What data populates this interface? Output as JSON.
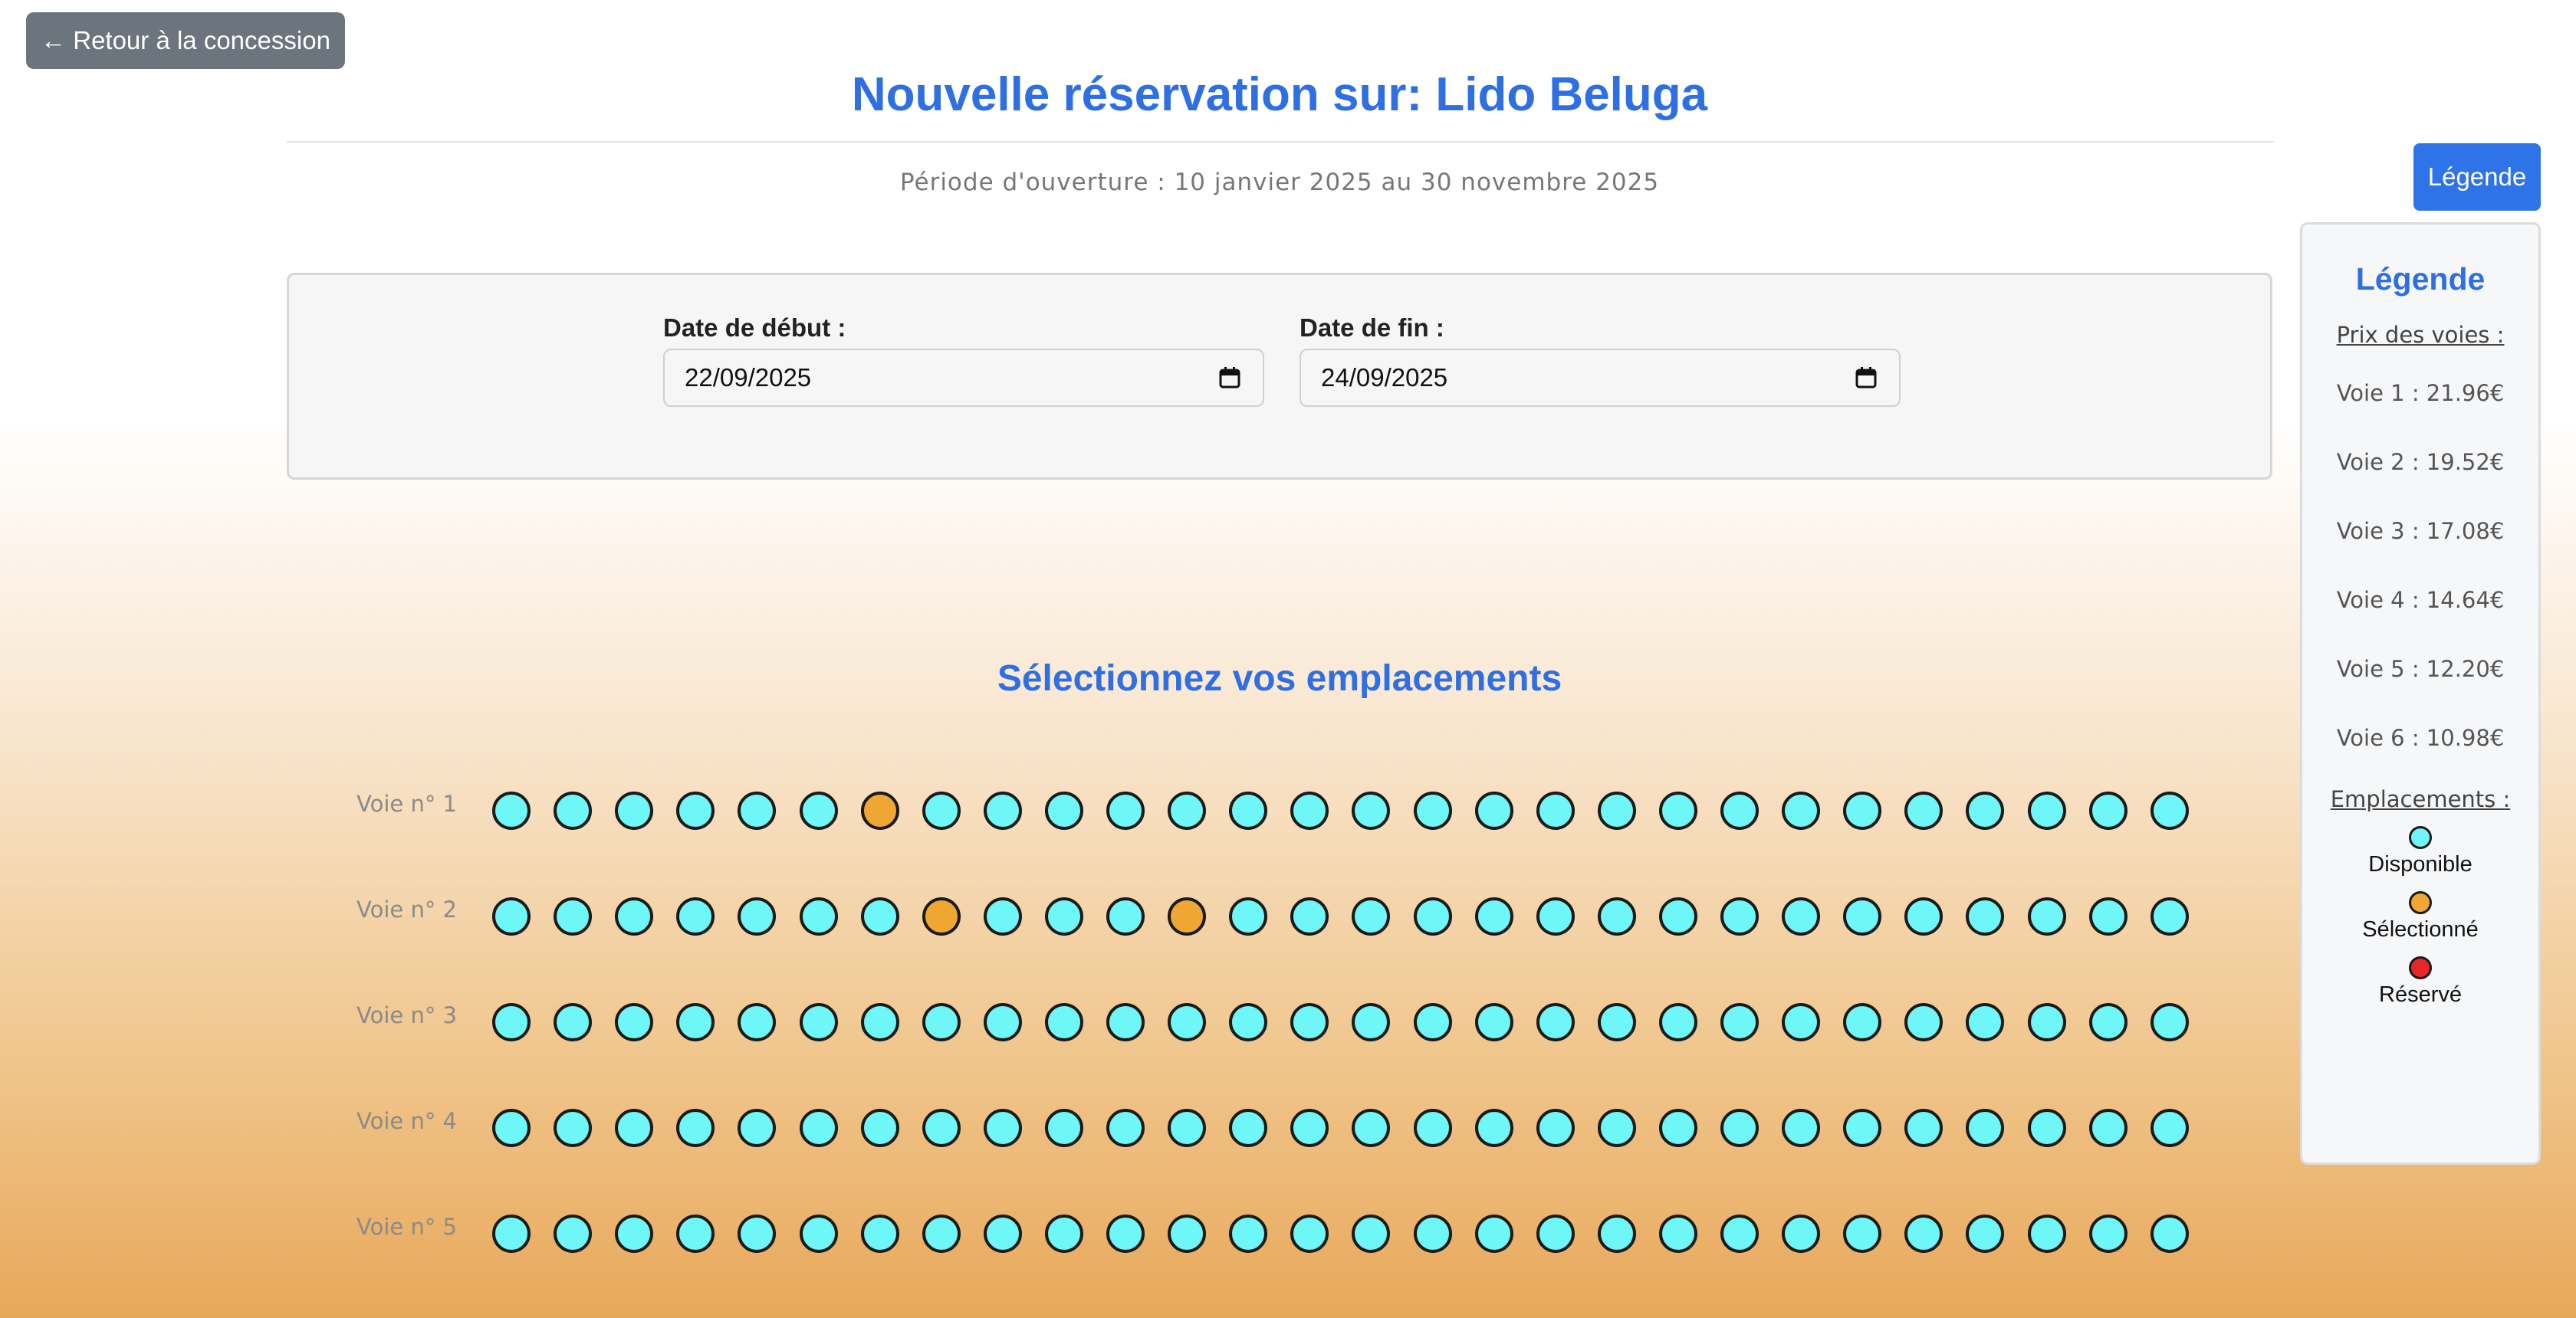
{
  "back_button": {
    "label": "← Retour à la concession"
  },
  "page": {
    "title": "Nouvelle réservation sur: Lido Beluga",
    "period": "Période d'ouverture : 10 janvier 2025 au 30 novembre 2025"
  },
  "dates": {
    "start_label": "Date de début :",
    "start_value": "22/09/2025",
    "end_label": "Date de fin :",
    "end_value": "24/09/2025"
  },
  "seating": {
    "title": "Sélectionnez vos emplacements",
    "seats_per_row": 28,
    "rows": [
      {
        "label": "Voie n° 1",
        "selected": [
          7
        ]
      },
      {
        "label": "Voie n° 2",
        "selected": [
          8,
          12
        ]
      },
      {
        "label": "Voie n° 3",
        "selected": []
      },
      {
        "label": "Voie n° 4",
        "selected": []
      },
      {
        "label": "Voie n° 5",
        "selected": []
      }
    ]
  },
  "legend": {
    "button_label": "Légende",
    "title": "Légende",
    "prices_title": "Prix des voies :",
    "prices": [
      "Voie 1 : 21.96€",
      "Voie 2 : 19.52€",
      "Voie 3 : 17.08€",
      "Voie 4 : 14.64€",
      "Voie 5 : 12.20€",
      "Voie 6 : 10.98€"
    ],
    "slots_title": "Emplacements :",
    "statuses": [
      {
        "label": "Disponible",
        "color": "#6ff6f6"
      },
      {
        "label": "Sélectionné",
        "color": "#efa632"
      },
      {
        "label": "Réservé",
        "color": "#e8262a"
      }
    ]
  },
  "colors": {
    "accent": "#2f6fe4",
    "available": "#6ff6f6",
    "selected": "#efa632",
    "reserved": "#e8262a"
  }
}
